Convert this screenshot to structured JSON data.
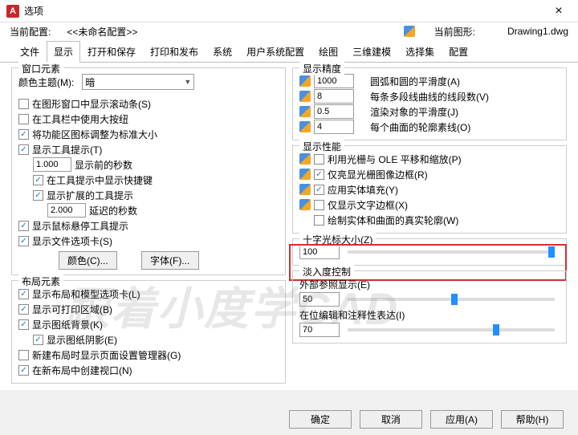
{
  "title": "选项",
  "config": {
    "current_config_label": "当前配置:",
    "current_config_value": "<<未命名配置>>",
    "current_drawing_label": "当前图形:",
    "current_drawing_value": "Drawing1.dwg"
  },
  "tabs": [
    "文件",
    "显示",
    "打开和保存",
    "打印和发布",
    "系统",
    "用户系统配置",
    "绘图",
    "三维建模",
    "选择集",
    "配置"
  ],
  "active_tab": "显示",
  "left": {
    "window_elements": {
      "legend": "窗口元素",
      "color_theme_label": "颜色主题(M):",
      "color_theme_value": "暗",
      "chk_scrollbar": "在图形窗口中显示滚动条(S)",
      "chk_bigbutton": "在工具栏中使用大按纽",
      "chk_ribbon": "将功能区图标调整为标准大小",
      "chk_tooltips": "显示工具提示(T)",
      "secs_before": "1.000",
      "secs_before_label": "显示前的秒数",
      "chk_shortcut": "在工具提示中显示快捷键",
      "chk_extended": "显示扩展的工具提示",
      "delay": "2.000",
      "delay_label": "延迟的秒数",
      "chk_hover": "显示鼠标悬停工具提示",
      "chk_filetabs": "显示文件选项卡(S)",
      "btn_color": "颜色(C)...",
      "btn_font": "字体(F)..."
    },
    "layout_elements": {
      "legend": "布局元素",
      "chk_layouttabs": "显示布局和模型选项卡(L)",
      "chk_printable": "显示可打印区域(B)",
      "chk_paperbg": "显示图纸背景(K)",
      "chk_shadow": "显示图纸阴影(E)",
      "chk_pagesetup": "新建布局时显示页面设置管理器(G)",
      "chk_viewport": "在新布局中创建视口(N)"
    }
  },
  "right": {
    "precision": {
      "legend": "显示精度",
      "arc_val": "1000",
      "arc_label": "圆弧和圆的平滑度(A)",
      "poly_val": "8",
      "poly_label": "每条多段线曲线的线段数(V)",
      "render_val": "0.5",
      "render_label": "渲染对象的平滑度(J)",
      "surf_val": "4",
      "surf_label": "每个曲面的轮廓素线(O)"
    },
    "performance": {
      "legend": "显示性能",
      "chk_raster": "利用光栅与 OLE 平移和缩放(P)",
      "chk_raster_frame": "仅亮显光栅图像边框(R)",
      "chk_solidfill": "应用实体填充(Y)",
      "chk_textframe": "仅显示文字边框(X)",
      "chk_silhouette": "绘制实体和曲面的真实轮廓(W)"
    },
    "crosshair": {
      "legend": "十字光标大小(Z)",
      "value": "100"
    },
    "fade": {
      "legend": "淡入度控制",
      "xref_label": "外部参照显示(E)",
      "xref_val": "50",
      "inplace_label": "在位编辑和注释性表达(I)",
      "inplace_val": "70"
    }
  },
  "footer": {
    "ok": "确定",
    "cancel": "取消",
    "apply": "应用(A)",
    "help": "帮助(H)"
  },
  "watermark": "跟着小度学CAD"
}
